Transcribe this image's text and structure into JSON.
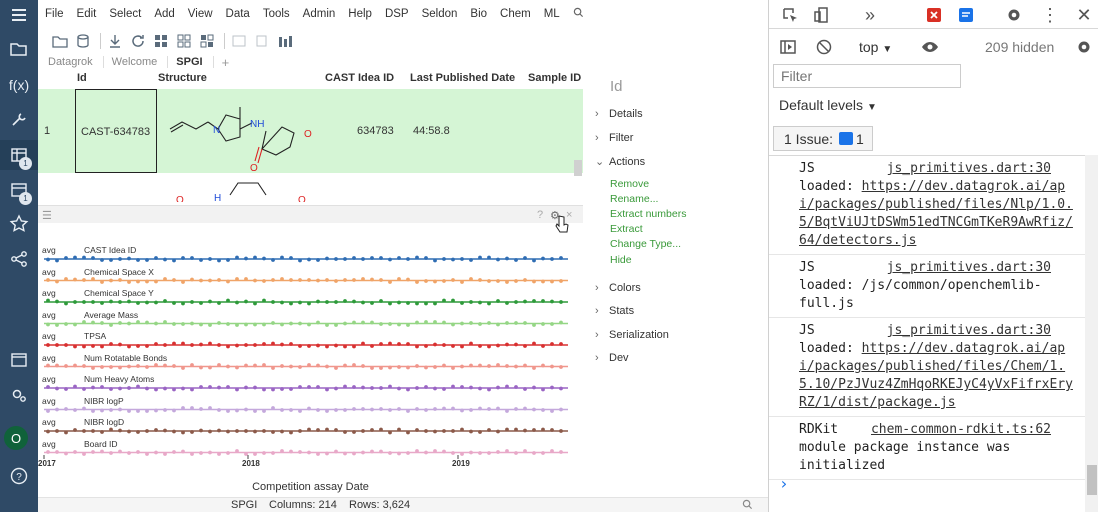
{
  "menubar": {
    "items": [
      "File",
      "Edit",
      "Select",
      "Add",
      "View",
      "Data",
      "Tools",
      "Admin",
      "Help",
      "DSP",
      "Seldon",
      "Bio",
      "Chem",
      "ML"
    ],
    "search_icon": "search-icon"
  },
  "sidebar": {
    "badges": {
      "tables": "1",
      "projects": "1"
    },
    "avatar": "O"
  },
  "tabs": [
    "Datagrok",
    "Welcome",
    "SPGI"
  ],
  "tab_plus": "+",
  "grid": {
    "columns": [
      "Id",
      "Structure",
      "CAST Idea ID",
      "Last Published Date",
      "Sample ID"
    ],
    "row1": {
      "index": "1",
      "id": "CAST-634783",
      "cast_idea_id": "634783",
      "last_published": "44:58.8"
    },
    "molecule_labels": {
      "nh": "NH",
      "o_ring": "O",
      "o_carbonyl": "O",
      "n": "N"
    },
    "row2_labels": {
      "o": "O",
      "h": "H"
    }
  },
  "chart": {
    "rows": [
      {
        "avg": "avg",
        "name": "CAST Idea ID",
        "color": "#2f6db3"
      },
      {
        "avg": "avg",
        "name": "Chemical Space X",
        "color": "#f0a468"
      },
      {
        "avg": "avg",
        "name": "Chemical Space Y",
        "color": "#2e9a3a"
      },
      {
        "avg": "avg",
        "name": "Average Mass",
        "color": "#95d685"
      },
      {
        "avg": "avg",
        "name": "TPSA",
        "color": "#d83030"
      },
      {
        "avg": "avg",
        "name": "Num Rotatable Bonds",
        "color": "#f0968c"
      },
      {
        "avg": "avg",
        "name": "Num Heavy Atoms",
        "color": "#9a65c4"
      },
      {
        "avg": "avg",
        "name": "NIBR logP",
        "color": "#c4a8dc"
      },
      {
        "avg": "avg",
        "name": "NIBR logD",
        "color": "#8c5a4a"
      },
      {
        "avg": "avg",
        "name": "Board ID",
        "color": "#e8a8c8"
      }
    ],
    "x_ticks": [
      "2017",
      "2018",
      "2019"
    ],
    "x_axis_label": "Competition assay Date",
    "header_icons": {
      "help": "?",
      "settings": "gear-icon",
      "close": "×"
    }
  },
  "properties": {
    "title": "Id",
    "sections": [
      "Details",
      "Filter",
      "Actions",
      "Colors",
      "Stats",
      "Serialization",
      "Dev"
    ],
    "actions": [
      "Remove",
      "Rename...",
      "Extract numbers",
      "Extract",
      "Change Type...",
      "Hide"
    ]
  },
  "statusbar": {
    "table": "SPGI",
    "columns": "Columns: 214",
    "rows": "Rows: 3,624"
  },
  "devtools": {
    "context": "top",
    "hidden": "209 hidden",
    "filter_placeholder": "Filter",
    "levels": "Default levels",
    "issue_text": "1 Issue:",
    "issue_count": "1",
    "messages": [
      {
        "prefix": "JS",
        "source": "js_primitives.dart:30",
        "text": "loaded:",
        "url": "https://dev.datagrok.ai/api/packages/published/files/Nlp/1.0.5/BqtViUJtDSWm51edTNCGmTKeR9AwRfiz/64/detectors.js"
      },
      {
        "prefix": "JS",
        "source": "js_primitives.dart:30",
        "text": "loaded: /js/common/openchemlib-full.js",
        "url": ""
      },
      {
        "prefix": "JS",
        "source": "js_primitives.dart:30",
        "text": "loaded:",
        "url": "https://dev.datagrok.ai/api/packages/published/files/Chem/1.5.10/PzJVuz4ZmHqoRKEJyC4yVxFifrxEryRZ/1/dist/package.js"
      },
      {
        "prefix": "RDKit",
        "source": "chem-common-rdkit.ts:62",
        "text": "module package instance was initialized",
        "url": ""
      }
    ],
    "prompt": "›"
  }
}
